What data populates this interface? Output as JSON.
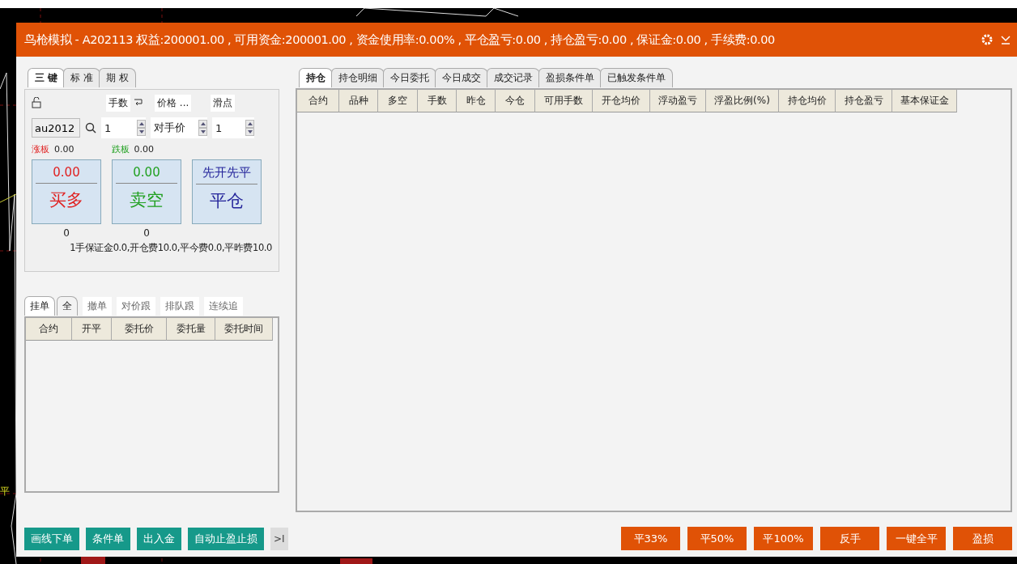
{
  "window": {
    "title": "鸟枪模拟 - A202113 权益:200001.00 , 可用资金:200001.00 , 资金使用率:0.00% , 平仓盈亏:0.00 , 持仓盈亏:0.00 , 保证金:0.00 , 手续费:0.00"
  },
  "edge_label": "平",
  "order_panel": {
    "tabs": [
      {
        "label": "三 键",
        "selected": true
      },
      {
        "label": "标 准",
        "selected": false
      },
      {
        "label": "期 权",
        "selected": false
      }
    ],
    "quantity_label": "手数",
    "price_label": "价格 ...",
    "slippage_label": "滑点",
    "symbol": "au2012",
    "quantity": "1",
    "price_type": "对手价",
    "slippage": "1",
    "limit_up_label": "涨板",
    "limit_up": "0.00",
    "limit_down_label": "跌板",
    "limit_down": "0.00",
    "trade_buttons": [
      {
        "kind": "buy",
        "price": "0.00",
        "label": "买多",
        "count": "0"
      },
      {
        "kind": "sell",
        "price": "0.00",
        "label": "卖空",
        "count": "0"
      },
      {
        "kind": "close",
        "price": "先开先平",
        "label": "平仓"
      }
    ],
    "fee_note": "1手保证金0.0,开仓费10.0,平今费0.0,平昨费10.0"
  },
  "orders_panel": {
    "tabs": [
      {
        "label": "挂单",
        "selected": true
      },
      {
        "label": "全",
        "selected": false
      }
    ],
    "actions": [
      "撤单",
      "对价跟",
      "排队跟",
      "连续追"
    ],
    "columns": [
      "合约",
      "开平",
      "委托价",
      "委托量",
      "委托时间"
    ]
  },
  "positions_panel": {
    "tabs": [
      {
        "label": "持仓",
        "selected": true
      },
      {
        "label": "持仓明细",
        "selected": false
      },
      {
        "label": "今日委托",
        "selected": false
      },
      {
        "label": "今日成交",
        "selected": false
      },
      {
        "label": "成交记录",
        "selected": false
      },
      {
        "label": "盈损条件单",
        "selected": false
      },
      {
        "label": "已触发条件单",
        "selected": false
      }
    ],
    "columns": [
      "合约",
      "品种",
      "多空",
      "手数",
      "昨仓",
      "今仓",
      "可用手数",
      "开仓均价",
      "浮动盈亏",
      "浮盈比例(%)",
      "持仓均价",
      "持仓盈亏",
      "基本保证金"
    ]
  },
  "left_buttons": [
    "画线下单",
    "条件单",
    "出入金",
    "自动止盈止损"
  ],
  "expand_label": ">I",
  "right_buttons": [
    "平33%",
    "平50%",
    "平100%",
    "反手",
    "一键全平",
    "盈损"
  ]
}
